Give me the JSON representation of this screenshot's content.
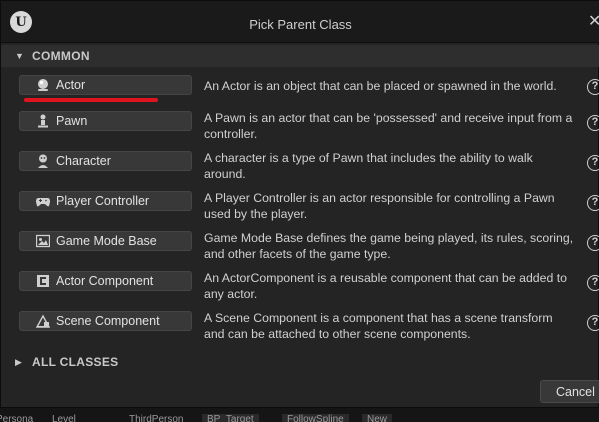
{
  "dialog": {
    "title": "Pick Parent Class"
  },
  "common": {
    "label": "COMMON",
    "items": [
      {
        "label": "Actor",
        "icon": "actor-icon",
        "description": "An Actor is an object that can be placed or spawned in the world."
      },
      {
        "label": "Pawn",
        "icon": "pawn-icon",
        "description": "A Pawn is an actor that can be 'possessed' and receive input from a controller."
      },
      {
        "label": "Character",
        "icon": "character-icon",
        "description": "A character is a type of Pawn that includes the ability to walk around."
      },
      {
        "label": "Player Controller",
        "icon": "gamepad-icon",
        "description": "A Player Controller is an actor responsible for controlling a Pawn used by the player."
      },
      {
        "label": "Game Mode Base",
        "icon": "game-mode-icon",
        "description": "Game Mode Base defines the game being played, its rules, scoring, and other facets of the game type."
      },
      {
        "label": "Actor Component",
        "icon": "actor-component-icon",
        "description": "An ActorComponent is a reusable component that can be added to any actor."
      },
      {
        "label": "Scene Component",
        "icon": "scene-component-icon",
        "description": "A Scene Component is a component that has a scene transform and can be attached to other scene components."
      }
    ]
  },
  "all_classes": {
    "label": "ALL CLASSES"
  },
  "footer": {
    "cancel_label": "Cancel"
  },
  "taskbar": {
    "items": [
      "Persona",
      "Level",
      "ThirdPerson",
      "BP_Target",
      "FollowSpline",
      "New"
    ]
  },
  "colors": {
    "highlight_underline": "#e0141e",
    "dialog_bg": "#242424"
  }
}
